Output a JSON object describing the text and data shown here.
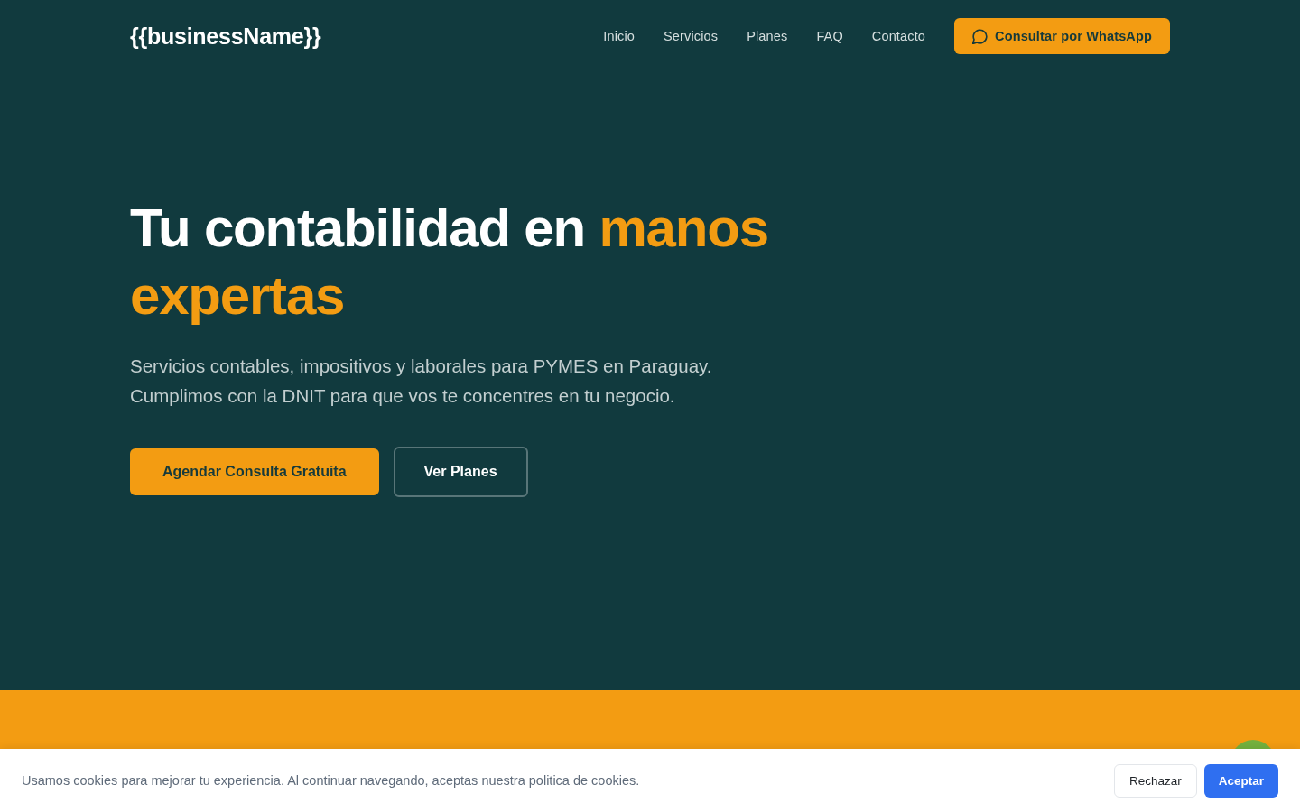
{
  "nav": {
    "logo": "{{businessName}}",
    "links": [
      {
        "label": "Inicio"
      },
      {
        "label": "Servicios"
      },
      {
        "label": "Planes"
      },
      {
        "label": "FAQ"
      },
      {
        "label": "Contacto"
      }
    ],
    "cta": {
      "label": "Consultar por WhatsApp"
    }
  },
  "hero": {
    "headline": {
      "text": "Tu contabilidad en",
      "highlight": "manos expertas"
    },
    "subtitle": "Servicios contables, impositivos y laborales para PYMES en Paraguay. Cumplimos con la DNIT para que vos te concentres en tu negocio.",
    "buttons": [
      {
        "label": "Agendar Consulta Gratuita",
        "kind": "primary"
      },
      {
        "label": "Ver Planes",
        "kind": "outline"
      }
    ]
  },
  "cookie_banner": {
    "message": "Usamos cookies para mejorar tu experiencia. Al continuar navegando, aceptas nuestra politica de cookies.",
    "buttons": [
      {
        "label": "Rechazar",
        "kind": "secondary"
      },
      {
        "label": "Aceptar",
        "kind": "primary"
      }
    ]
  }
}
